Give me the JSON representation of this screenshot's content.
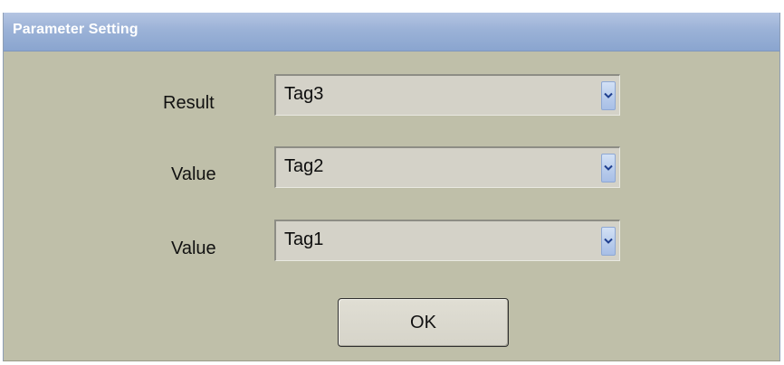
{
  "window": {
    "title": "Parameter Setting"
  },
  "fields": [
    {
      "label": "Result",
      "selected": "Tag3"
    },
    {
      "label": "Value",
      "selected": "Tag2"
    },
    {
      "label": "Value",
      "selected": "Tag1"
    }
  ],
  "ok_button": {
    "label": "OK"
  },
  "icons": {
    "dropdown": "chevron-down-icon"
  },
  "colors": {
    "title_bar": "#9bb2d7",
    "background": "#bfbfa9",
    "dropdown_button": "#b7cbeb"
  }
}
